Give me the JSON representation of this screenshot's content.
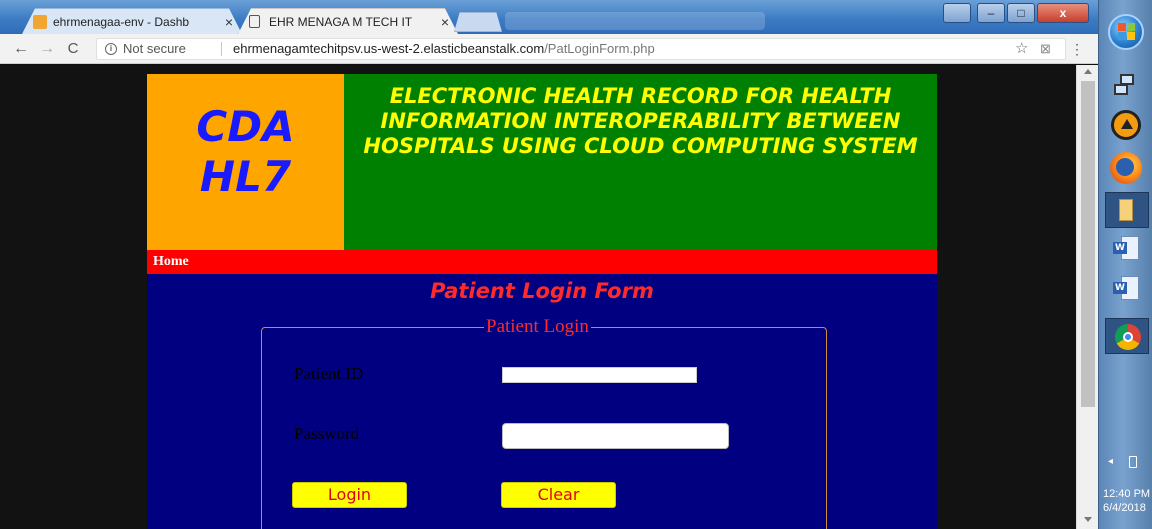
{
  "browser": {
    "tabs": [
      {
        "label": "ehrmenagaa-env - Dashb",
        "active": false
      },
      {
        "label": "EHR MENAGA M TECH IT",
        "active": true
      }
    ],
    "security_label": "Not secure",
    "url_host": "ehrmenagamtechitpsv.us-west-2.elasticbeanstalk.com",
    "url_path": "/PatLoginForm.php",
    "window_buttons": {
      "minimize": "–",
      "maximize": "□",
      "close": "x"
    }
  },
  "site": {
    "logo_line1": "CDA",
    "logo_line2": "HL7",
    "header_title": "ELECTRONIC HEALTH RECORD FOR HEALTH INFORMATION INTEROPERABILITY BETWEEN HOSPITALS USING CLOUD COMPUTING SYSTEM",
    "nav": {
      "home": "Home"
    },
    "form": {
      "title": "Patient Login Form",
      "legend": "Patient Login",
      "patient_id_label": "Patient ID",
      "password_label": "Password",
      "patient_id_value": "",
      "password_value": "",
      "login_button": "Login",
      "clear_button": "Clear"
    },
    "colors": {
      "logo_bg": "#ffa500",
      "logo_text": "#1a1aff",
      "header_bg": "#008000",
      "header_text": "#ffff00",
      "nav_bg": "#ff0000",
      "content_bg": "#000080",
      "form_title": "#ff2a2a",
      "button_bg": "#ffff00"
    }
  },
  "taskbar": {
    "icons": [
      "start-orb-icon",
      "network-icon",
      "vlc-icon",
      "firefox-icon",
      "folder-icon",
      "word-document-icon",
      "word-document-icon",
      "chrome-icon"
    ],
    "clock_time": "12:40 PM",
    "clock_date": "6/4/2018"
  }
}
